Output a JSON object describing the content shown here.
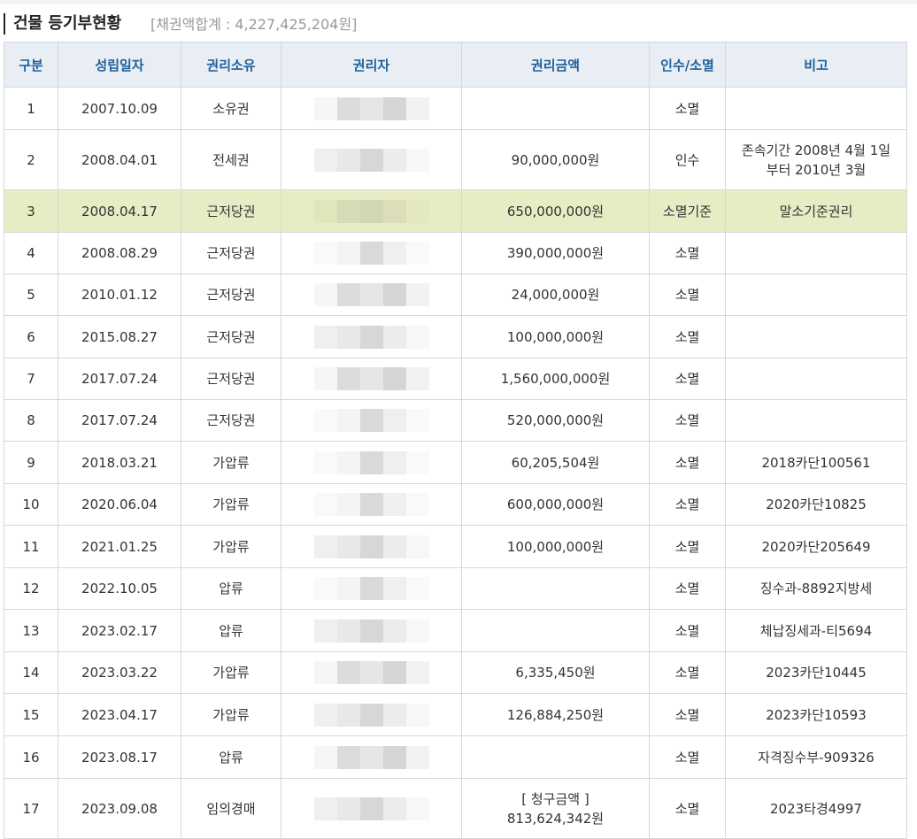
{
  "header": {
    "title": "건물 등기부현황",
    "summary": "[채권액합계 : 4,227,425,204원]"
  },
  "columns": [
    "구분",
    "성립일자",
    "권리소유",
    "권리자",
    "권리금액",
    "인수/소멸",
    "비고"
  ],
  "rows": [
    {
      "no": "1",
      "date": "2007.10.09",
      "type": "소유권",
      "amount": "",
      "status": "소멸",
      "note": ""
    },
    {
      "no": "2",
      "date": "2008.04.01",
      "type": "전세권",
      "amount": "90,000,000원",
      "status": "인수",
      "note": "존속기간 2008년 4월 1일 부터 2010년 3월"
    },
    {
      "no": "3",
      "date": "2008.04.17",
      "type": "근저당권",
      "amount": "650,000,000원",
      "status": "소멸기준",
      "note": "말소기준권리",
      "highlight": true
    },
    {
      "no": "4",
      "date": "2008.08.29",
      "type": "근저당권",
      "amount": "390,000,000원",
      "status": "소멸",
      "note": ""
    },
    {
      "no": "5",
      "date": "2010.01.12",
      "type": "근저당권",
      "amount": "24,000,000원",
      "status": "소멸",
      "note": ""
    },
    {
      "no": "6",
      "date": "2015.08.27",
      "type": "근저당권",
      "amount": "100,000,000원",
      "status": "소멸",
      "note": ""
    },
    {
      "no": "7",
      "date": "2017.07.24",
      "type": "근저당권",
      "amount": "1,560,000,000원",
      "status": "소멸",
      "note": ""
    },
    {
      "no": "8",
      "date": "2017.07.24",
      "type": "근저당권",
      "amount": "520,000,000원",
      "status": "소멸",
      "note": ""
    },
    {
      "no": "9",
      "date": "2018.03.21",
      "type": "가압류",
      "amount": "60,205,504원",
      "status": "소멸",
      "note": "2018카단100561"
    },
    {
      "no": "10",
      "date": "2020.06.04",
      "type": "가압류",
      "amount": "600,000,000원",
      "status": "소멸",
      "note": "2020카단10825"
    },
    {
      "no": "11",
      "date": "2021.01.25",
      "type": "가압류",
      "amount": "100,000,000원",
      "status": "소멸",
      "note": "2020카단205649"
    },
    {
      "no": "12",
      "date": "2022.10.05",
      "type": "압류",
      "amount": "",
      "status": "소멸",
      "note": "징수과-8892지방세"
    },
    {
      "no": "13",
      "date": "2023.02.17",
      "type": "압류",
      "amount": "",
      "status": "소멸",
      "note": "체납징세과-티5694"
    },
    {
      "no": "14",
      "date": "2023.03.22",
      "type": "가압류",
      "amount": "6,335,450원",
      "status": "소멸",
      "note": "2023카단10445"
    },
    {
      "no": "15",
      "date": "2023.04.17",
      "type": "가압류",
      "amount": "126,884,250원",
      "status": "소멸",
      "note": "2023카단10593"
    },
    {
      "no": "16",
      "date": "2023.08.17",
      "type": "압류",
      "amount": "",
      "status": "소멸",
      "note": "자격징수부-909326"
    },
    {
      "no": "17",
      "date": "2023.09.08",
      "type": "임의경매",
      "amount": "[ 청구금액 ] 813,624,342원",
      "status": "소멸",
      "note": "2023타경4997"
    }
  ],
  "colors": {
    "header_bg": "#e9eef4",
    "header_text": "#1f5f99",
    "highlight_row": "#e8ecc4",
    "highlight_text": "#e02a2a"
  }
}
